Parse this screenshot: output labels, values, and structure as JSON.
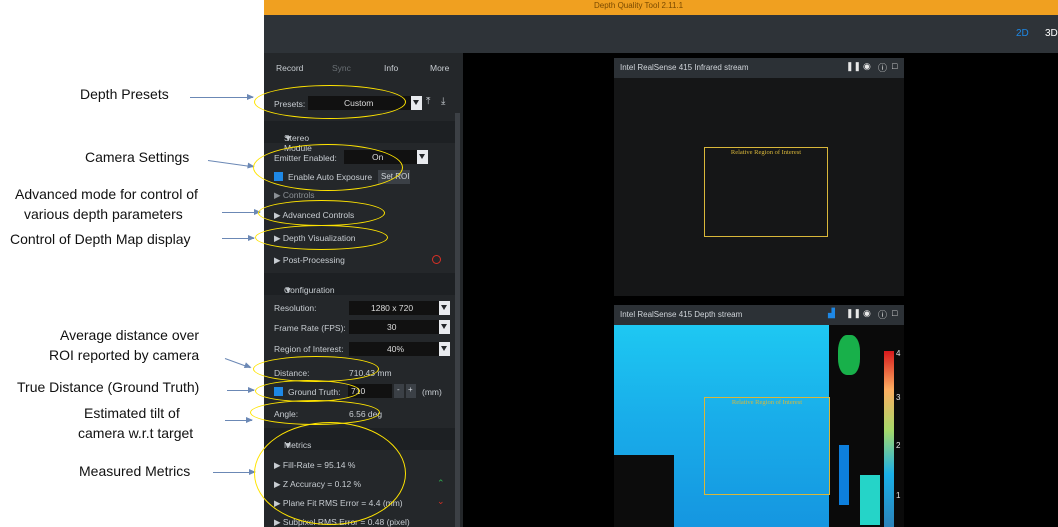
{
  "annotations": {
    "depth_presets": "Depth Presets",
    "camera_settings": "Camera Settings",
    "advanced_mode_line1": "Advanced mode for control of",
    "advanced_mode_line2": "various depth parameters",
    "depth_map_display": "Control of Depth Map display",
    "avg_distance_line1": "Average distance over",
    "avg_distance_line2": "ROI reported by camera",
    "true_distance": "True Distance (Ground Truth)",
    "tilt_line1": "Estimated tilt of",
    "tilt_line2": "camera w.r.t target",
    "measured_metrics": "Measured Metrics"
  },
  "window": {
    "title": "Depth Quality Tool 2.11.1"
  },
  "toolbar": {
    "mode_2d": "2D",
    "mode_3d": "3D"
  },
  "colors": {
    "title_bar": "#f0a020",
    "accent": "#1e88e5",
    "highlight_ellipse": "#ffe400",
    "roi": "#d9b73a"
  },
  "sidebar": {
    "tabs": {
      "record": "Record",
      "sync": "Sync",
      "info": "Info",
      "more": "More"
    },
    "presets_label": "Presets:",
    "presets_value": "Custom",
    "stereo_module": "Stereo Module",
    "emitter_label": "Emitter Enabled:",
    "emitter_value": "On",
    "auto_exposure": "Enable Auto Exposure",
    "set_roi": "Set ROI",
    "controls": "Controls",
    "advanced_controls": "Advanced Controls",
    "depth_visualization": "Depth Visualization",
    "post_processing": "Post-Processing",
    "configuration": "Configuration",
    "resolution_label": "Resolution:",
    "resolution_value": "1280 x 720",
    "frame_rate_label": "Frame Rate (FPS):",
    "frame_rate_value": "30",
    "roi_label": "Region of Interest:",
    "roi_value": "40%",
    "distance_label": "Distance:",
    "distance_value": "710.43 mm",
    "ground_truth_label": "Ground Truth:",
    "ground_truth_value": "710",
    "ground_truth_unit": "(mm)",
    "angle_label": "Angle:",
    "angle_value": "6.56 deg",
    "metrics": "Metrics",
    "metric_items": {
      "fill_rate": "Fill-Rate = 95.14 %",
      "z_accuracy": "Z Accuracy = 0.12 %",
      "plane_fit": "Plane Fit RMS Error = 4.4 (mm)",
      "subpixel": "Subpixel RMS Error = 0.48 (pixel)"
    }
  },
  "streams": {
    "infrared_title": "Intel RealSense 415 Infrared stream",
    "depth_title": "Intel RealSense 415 Depth stream",
    "roi_label": "Relative Region of Interest"
  },
  "colorbar": {
    "ticks": [
      "4",
      "3",
      "2",
      "1"
    ]
  }
}
